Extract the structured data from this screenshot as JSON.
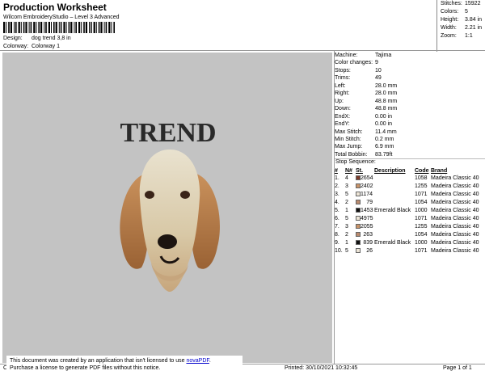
{
  "header": {
    "title": "Production Worksheet",
    "subtitle": "Wilcom EmbroideryStudio – Level 3 Advanced",
    "design_label": "Design:",
    "design_value": "dog  trend 3,8 in",
    "colorway_label": "Colorway:",
    "colorway_value": "Colorway 1"
  },
  "summary": [
    {
      "k": "Stitches:",
      "v": "15922"
    },
    {
      "k": "Colors:",
      "v": "5"
    },
    {
      "k": "Height:",
      "v": "3.84 in"
    },
    {
      "k": "Width:",
      "v": "2.21 in"
    },
    {
      "k": "Zoom:",
      "v": "1:1"
    }
  ],
  "machine": [
    {
      "k": "Machine:",
      "v": "Tajima"
    },
    {
      "k": "Color changes:",
      "v": "9"
    },
    {
      "k": "Stops:",
      "v": "10"
    },
    {
      "k": "Trims:",
      "v": "49"
    },
    {
      "k": "Left:",
      "v": "28.0 mm"
    },
    {
      "k": "Right:",
      "v": "28.0 mm"
    },
    {
      "k": "Up:",
      "v": "48.8 mm"
    },
    {
      "k": "Down:",
      "v": "48.8 mm"
    },
    {
      "k": "EndX:",
      "v": "0.00 in"
    },
    {
      "k": "EndY:",
      "v": "0.00 in"
    },
    {
      "k": "Max Stitch:",
      "v": "11.4 mm"
    },
    {
      "k": "Min Stitch:",
      "v": "0.2 mm"
    },
    {
      "k": "Max Jump:",
      "v": "6.9 mm"
    },
    {
      "k": "Total Bobbin:",
      "v": "83.79ft"
    }
  ],
  "stop_sequence": {
    "title": "Stop Sequence:",
    "headers": [
      "#",
      "N#",
      "St.",
      "Description",
      "Code",
      "Brand"
    ],
    "rows": [
      {
        "n": "1.",
        "nn": "4",
        "color": "#7a3b2a",
        "st": "2654",
        "desc": "",
        "code": "1058",
        "brand": "Madeira Classic 40"
      },
      {
        "n": "2.",
        "nn": "3",
        "color": "#c8946a",
        "st": "2402",
        "desc": "",
        "code": "1255",
        "brand": "Madeira Classic 40"
      },
      {
        "n": "3.",
        "nn": "5",
        "color": "#ece4d6",
        "st": "1174",
        "desc": "",
        "code": "1071",
        "brand": "Madeira Classic 40"
      },
      {
        "n": "4.",
        "nn": "2",
        "color": "#b98a6e",
        "st": "79",
        "desc": "",
        "code": "1054",
        "brand": "Madeira Classic 40"
      },
      {
        "n": "5.",
        "nn": "1",
        "color": "#111111",
        "st": "1453",
        "desc": "Emerald Black",
        "code": "1000",
        "brand": "Madeira Classic 40"
      },
      {
        "n": "6.",
        "nn": "5",
        "color": "#ece4d6",
        "st": "4975",
        "desc": "",
        "code": "1071",
        "brand": "Madeira Classic 40"
      },
      {
        "n": "7.",
        "nn": "3",
        "color": "#c8946a",
        "st": "2055",
        "desc": "",
        "code": "1255",
        "brand": "Madeira Classic 40"
      },
      {
        "n": "8.",
        "nn": "2",
        "color": "#b98a6e",
        "st": "263",
        "desc": "",
        "code": "1054",
        "brand": "Madeira Classic 40"
      },
      {
        "n": "9.",
        "nn": "1",
        "color": "#111111",
        "st": "839",
        "desc": "Emerald Black",
        "code": "1000",
        "brand": "Madeira Classic 40"
      },
      {
        "n": "10.",
        "nn": "5",
        "color": "#ece4d6",
        "st": "26",
        "desc": "",
        "code": "1071",
        "brand": "Madeira Classic 40"
      }
    ]
  },
  "preview": {
    "embroidery_text": "TREND",
    "background_color": "#c3c3c3"
  },
  "notice": {
    "line1": "This document was created by an application that isn't licensed to use",
    "link": "novaPDF",
    "line1_end": ".",
    "line2": "Purchase a license to generate PDF files without this notice."
  },
  "footer": {
    "left": "Cr",
    "printed": "Printed: 30/10/2021 10:32:45",
    "page": "Page 1 of 1"
  }
}
